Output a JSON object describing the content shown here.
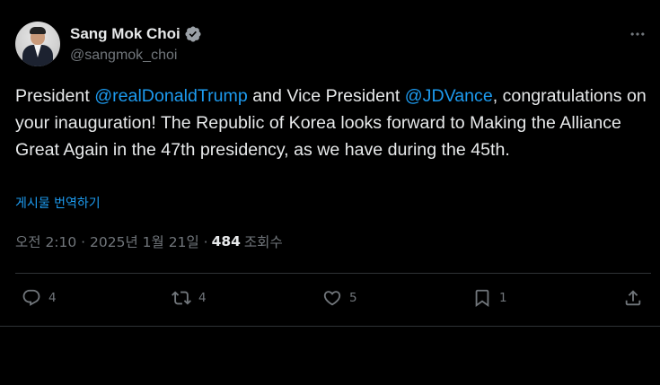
{
  "author": {
    "display_name": "Sang Mok Choi",
    "handle": "@sangmok_choi",
    "verified_icon": "verified-badge-icon",
    "verified_color": "#9aa0a6"
  },
  "post": {
    "text_1": "President ",
    "mention_1": "@realDonaldTrump",
    "text_2": " and Vice President ",
    "mention_2": "@JDVance",
    "text_3": ", congratulations on your inauguration! The Republic of Korea looks forward to Making the Alliance Great Again in the 47th presidency, as we have during the 45th.",
    "translate_label": "게시물 번역하기",
    "timestamp": "오전 2:10 · 2025년 1월 21일 · ",
    "views_count": "484",
    "views_label": "조회수"
  },
  "actions": {
    "reply_count": "4",
    "repost_count": "4",
    "like_count": "5",
    "bookmark_count": "1"
  },
  "colors": {
    "background": "#000000",
    "text_primary": "#e7e9ea",
    "text_secondary": "#71767b",
    "accent": "#1d9bf0",
    "border": "#2f3336"
  }
}
